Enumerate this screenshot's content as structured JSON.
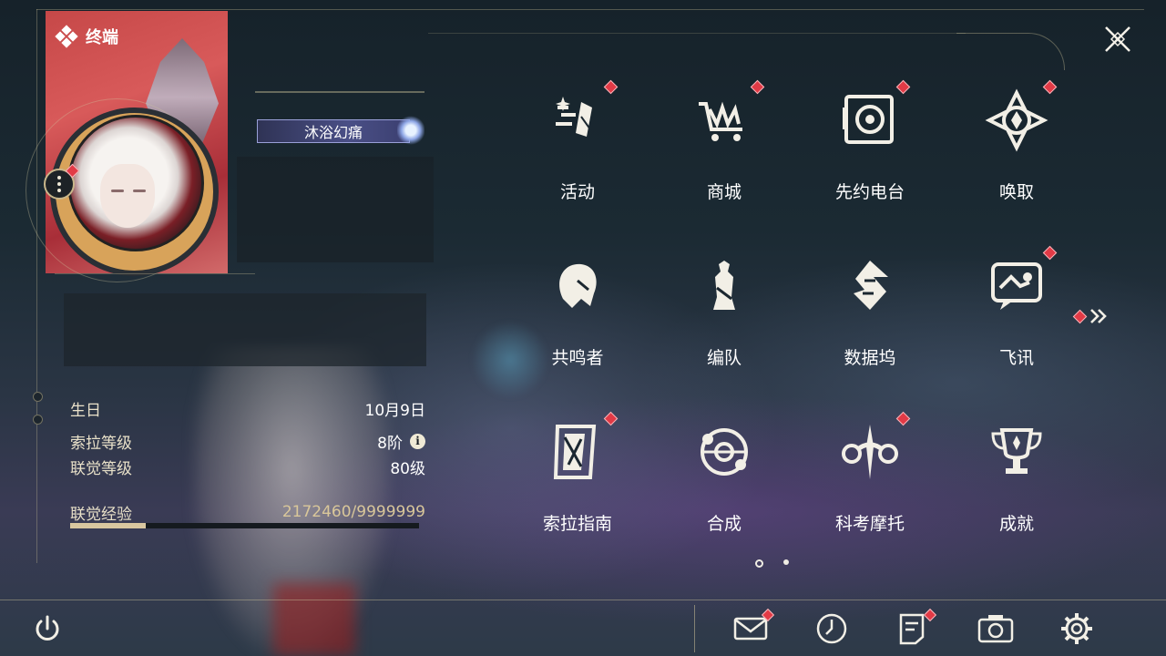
{
  "terminal": {
    "title": "终端"
  },
  "profile": {
    "title_badge": "沐浴幻痛",
    "stats": [
      {
        "label": "生日",
        "value": "10月9日"
      },
      {
        "label": "索拉等级",
        "value": "8阶"
      },
      {
        "label": "联觉等级",
        "value": "80级"
      }
    ],
    "exp": {
      "label": "联觉经验",
      "value": "2172460/9999999",
      "progress": 0.217
    }
  },
  "menu": [
    {
      "label": "活动",
      "icon": "activity-icon",
      "notify": true
    },
    {
      "label": "商城",
      "icon": "shop-cart-icon",
      "notify": true
    },
    {
      "label": "先约电台",
      "icon": "radio-icon",
      "notify": true
    },
    {
      "label": "唤取",
      "icon": "convene-icon",
      "notify": true
    },
    {
      "label": "共鸣者",
      "icon": "resonator-icon",
      "notify": false
    },
    {
      "label": "编队",
      "icon": "team-chess-icon",
      "notify": false
    },
    {
      "label": "数据坞",
      "icon": "data-bank-icon",
      "notify": false
    },
    {
      "label": "飞讯",
      "icon": "message-icon",
      "notify": true
    },
    {
      "label": "索拉指南",
      "icon": "guidebook-icon",
      "notify": true
    },
    {
      "label": "合成",
      "icon": "synthesis-icon",
      "notify": false
    },
    {
      "label": "科考摩托",
      "icon": "motorcycle-icon",
      "notify": true
    },
    {
      "label": "成就",
      "icon": "trophy-icon",
      "notify": false
    }
  ],
  "pagination": {
    "current": 1,
    "total": 2
  },
  "bottom_bar": [
    "power-icon",
    "mail-icon",
    "clock-icon",
    "notes-icon",
    "camera-icon",
    "settings-gear-icon"
  ],
  "colors": {
    "accent_gold": "#d9c7a0",
    "notify_red": "#e23a46",
    "text": "#ffffff"
  }
}
